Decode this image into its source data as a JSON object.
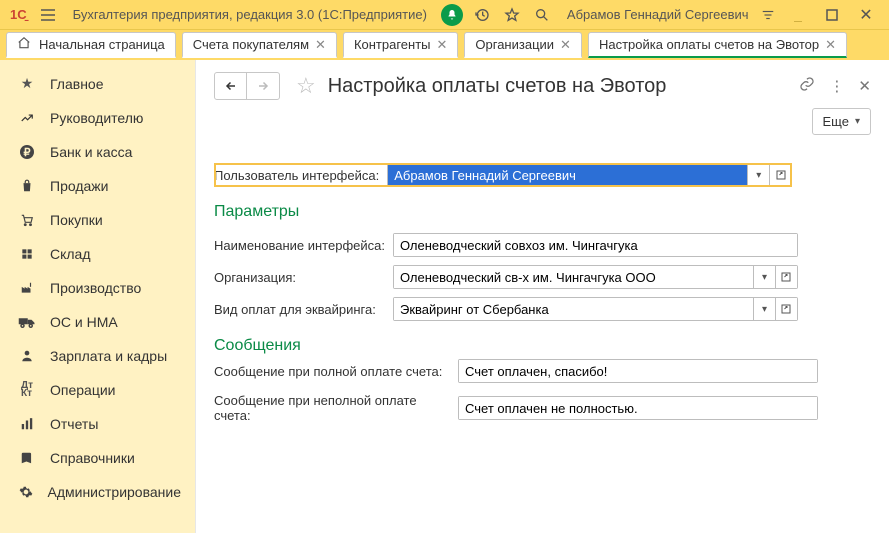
{
  "titlebar": {
    "app_title": "Бухгалтерия предприятия, редакция 3.0  (1С:Предприятие)",
    "user": "Абрамов Геннадий Сергеевич"
  },
  "tabs": {
    "home": "Начальная страница",
    "t1": "Счета покупателям",
    "t2": "Контрагенты",
    "t3": "Организации",
    "t4": "Настройка оплаты счетов на Эвотор"
  },
  "sidebar": {
    "items": [
      {
        "label": "Главное"
      },
      {
        "label": "Руководителю"
      },
      {
        "label": "Банк и касса"
      },
      {
        "label": "Продажи"
      },
      {
        "label": "Покупки"
      },
      {
        "label": "Склад"
      },
      {
        "label": "Производство"
      },
      {
        "label": "ОС и НМА"
      },
      {
        "label": "Зарплата и кадры"
      },
      {
        "label": "Операции"
      },
      {
        "label": "Отчеты"
      },
      {
        "label": "Справочники"
      },
      {
        "label": "Администрирование"
      }
    ]
  },
  "main": {
    "title": "Настройка оплаты счетов на Эвотор",
    "more": "Еще",
    "user_label": "Пользователь интерфейса:",
    "user_value": "Абрамов Геннадий Сергеевич",
    "section_params": "Параметры",
    "name_label": "Наименование интерфейса:",
    "name_value": "Оленеводческий совхоз им. Чингачгука",
    "org_label": "Организация:",
    "org_value": "Оленеводческий св-х им. Чингачгука ООО",
    "pay_label": "Вид оплат для эквайринга:",
    "pay_value": "Эквайринг от Сбербанка",
    "section_msgs": "Сообщения",
    "msg1_label": "Сообщение при полной оплате счета:",
    "msg1_value": "Счет оплачен, спасибо!",
    "msg2_label": "Сообщение при неполной оплате счета:",
    "msg2_value": "Счет оплачен не полностью."
  }
}
